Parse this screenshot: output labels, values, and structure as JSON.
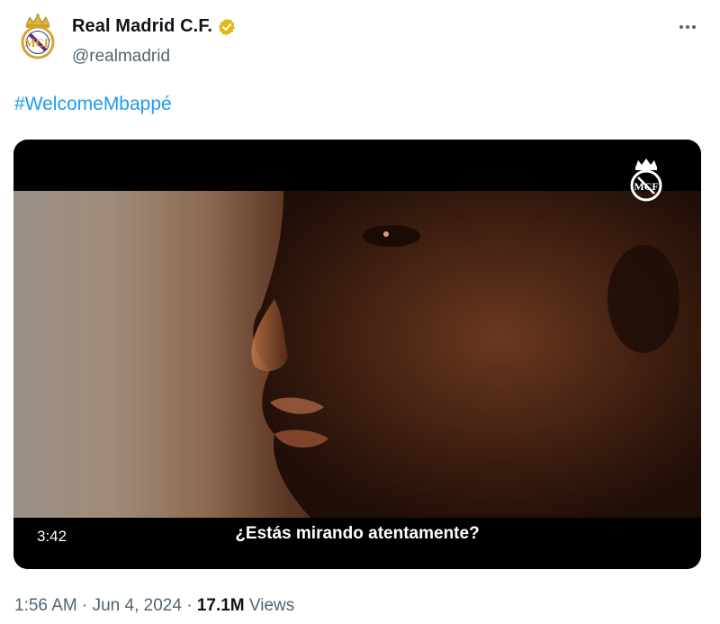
{
  "author": {
    "display_name": "Real Madrid C.F.",
    "handle": "@realmadrid",
    "verified": true,
    "badge_color": "#e2b719"
  },
  "tweet": {
    "text": "#WelcomeMbappé",
    "link_color": "#1d9bf0"
  },
  "media": {
    "type": "video",
    "duration": "3:42",
    "subtitle": "¿Estás mirando atentamente?"
  },
  "meta": {
    "time": "1:56 AM",
    "separator": "·",
    "date": "Jun 4, 2024",
    "views_count": "17.1M",
    "views_label": "Views"
  },
  "icons": {
    "more": "more-horizontal-icon",
    "verified": "verified-badge-icon",
    "crest": "real-madrid-crest"
  }
}
